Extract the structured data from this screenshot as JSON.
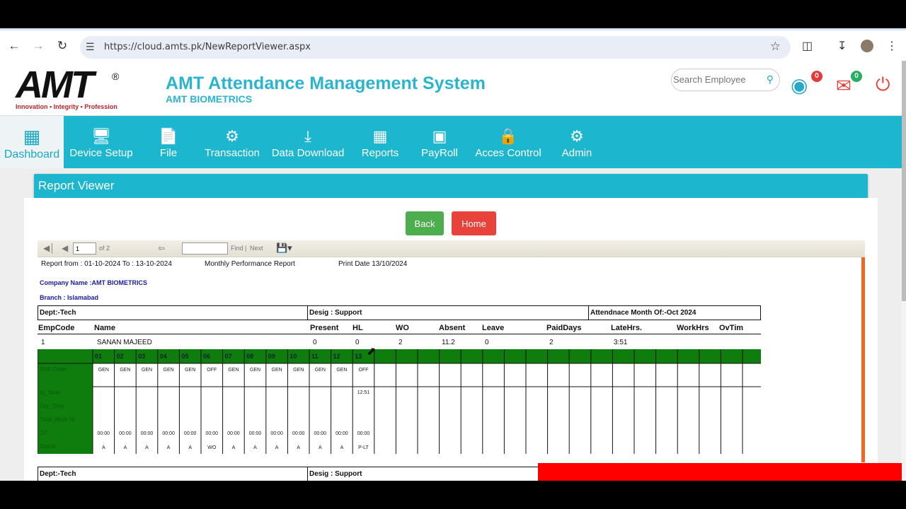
{
  "browser": {
    "url": "https://cloud.amts.pk/NewReportViewer.aspx"
  },
  "header": {
    "logo_text": "AMT",
    "logo_tagline": "Innovation • Integrity • Profession",
    "title": "AMT Attendance Management System",
    "subtitle": "AMT BIOMETRICS",
    "search_placeholder": "Search Employee",
    "location_badge": "0",
    "mail_badge": "0"
  },
  "nav": [
    {
      "label": "Dashboard",
      "icon": "dashboard-icon"
    },
    {
      "label": "Device Setup",
      "icon": "monitor-icon"
    },
    {
      "label": "File",
      "icon": "file-icon"
    },
    {
      "label": "Transaction",
      "icon": "gear-icon"
    },
    {
      "label": "Data Download",
      "icon": "download-icon"
    },
    {
      "label": "Reports",
      "icon": "calendar-icon"
    },
    {
      "label": "PayRoll",
      "icon": "money-icon"
    },
    {
      "label": "Acces Control",
      "icon": "lock-icon"
    },
    {
      "label": "Admin",
      "icon": "gears-icon"
    }
  ],
  "panel": {
    "title": "Report Viewer",
    "back_label": "Back",
    "home_label": "Home"
  },
  "viewer": {
    "page_value": "1",
    "page_of": "of 2",
    "find_label": "Find",
    "sep": "|",
    "next_label": "Next"
  },
  "report": {
    "range": "Report from : 01-10-2024 To : 13-10-2024",
    "name": "Monthly Performance Report",
    "print_date": "Print Date 13/10/2024",
    "company": "Company Name :AMT BIOMETRICS",
    "branch": "Branch : Islamabad",
    "dept": "Dept:-Tech",
    "desig": "Desig : Support",
    "month": "Attendnace Month Of:-Oct 2024",
    "columns": [
      "EmpCode",
      "Name",
      "Present",
      "HL",
      "WO",
      "Absent",
      "Leave",
      "PaidDays",
      "LateHrs.",
      "WorkHrs",
      "OvTim"
    ],
    "employee": [
      "1",
      "SANAN MAJEED",
      "0",
      "0",
      "2",
      "11.2",
      "0",
      "2",
      "3:51",
      "",
      ""
    ],
    "days": [
      "01",
      "02",
      "03",
      "04",
      "05",
      "06",
      "07",
      "08",
      "09",
      "10",
      "11",
      "12",
      "13"
    ],
    "row_labels": [
      "Shift Code",
      "In_Time",
      "Out_Time",
      "Total_Work Hr",
      "OT",
      "Status"
    ],
    "shift_codes": [
      "GEN",
      "GEN",
      "GEN",
      "GEN",
      "GEN",
      "OFF",
      "GEN",
      "GEN",
      "GEN",
      "GEN",
      "GEN",
      "GEN",
      "OFF"
    ],
    "in_times": [
      "",
      "",
      "",
      "",
      "",
      "",
      "",
      "",
      "",
      "",
      "",
      "",
      "12:51"
    ],
    "ot": [
      "00:00",
      "00:00",
      "00:00",
      "00:00",
      "00:00",
      "00:00",
      "00:00",
      "00:00",
      "00:00",
      "00:00",
      "00:00",
      "00:00",
      "00:00"
    ],
    "status": [
      "A",
      "A",
      "A",
      "A",
      "A",
      "WO",
      "A",
      "A",
      "A",
      "A",
      "A",
      "A",
      "P-LT"
    ],
    "dept2": "Dept:-Tech",
    "desig2": "Desig : Support"
  },
  "colors": {
    "accent": "#1cb6cf",
    "grid_green": "#0e7d0e",
    "back": "#4cae4c",
    "home": "#e8433a"
  }
}
